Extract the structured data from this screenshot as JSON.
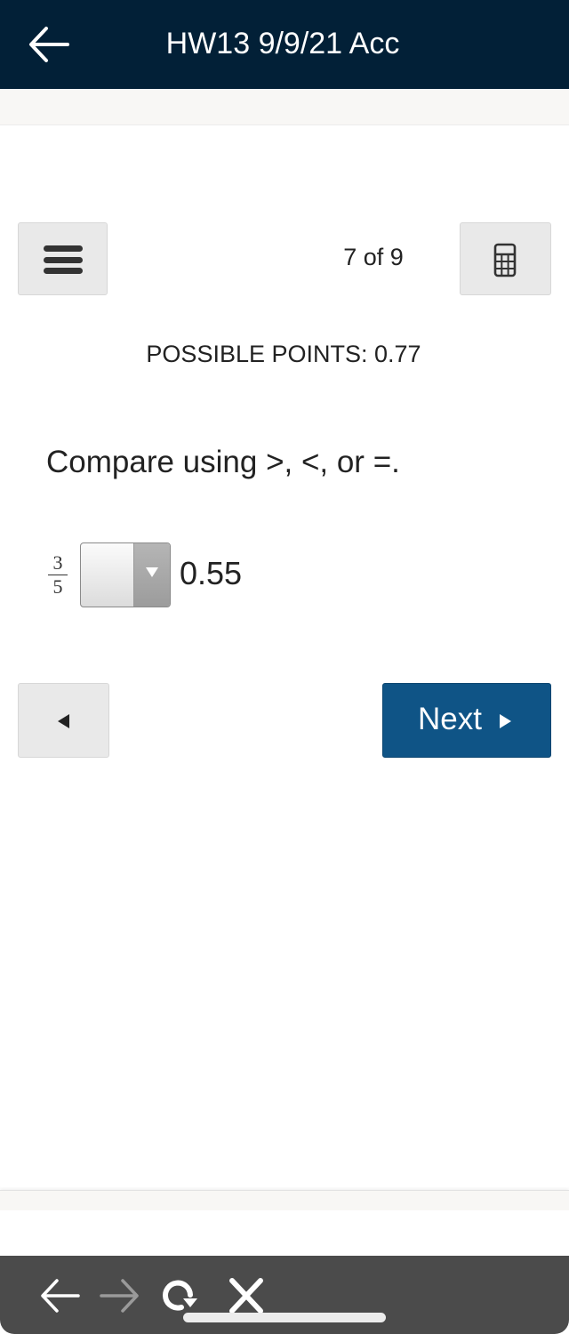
{
  "header": {
    "title": "HW13 9/9/21 Acc",
    "back_icon": "arrow-left-icon"
  },
  "toolbar": {
    "menu_icon": "hamburger-menu-icon",
    "question_counter": "7 of 9",
    "calculator_icon": "calculator-icon"
  },
  "question": {
    "possible_points": "POSSIBLE POINTS: 0.77",
    "prompt": "Compare using >, <, or =.",
    "fraction": {
      "numerator": "3",
      "denominator": "5"
    },
    "dropdown": {
      "selected": "",
      "options_hint": [
        ">",
        "<",
        "="
      ]
    },
    "compare_value": "0.55"
  },
  "navigation": {
    "previous_icon": "triangle-left-icon",
    "next_label": "Next",
    "next_icon": "triangle-right-icon"
  },
  "colors": {
    "header_bg": "#022037",
    "next_button_bg": "#0f5486",
    "browser_bar_bg": "#4b4b4b"
  },
  "browser_bar": {
    "icons": [
      "back-arrow-icon",
      "forward-arrow-icon",
      "reload-icon",
      "close-icon"
    ]
  }
}
